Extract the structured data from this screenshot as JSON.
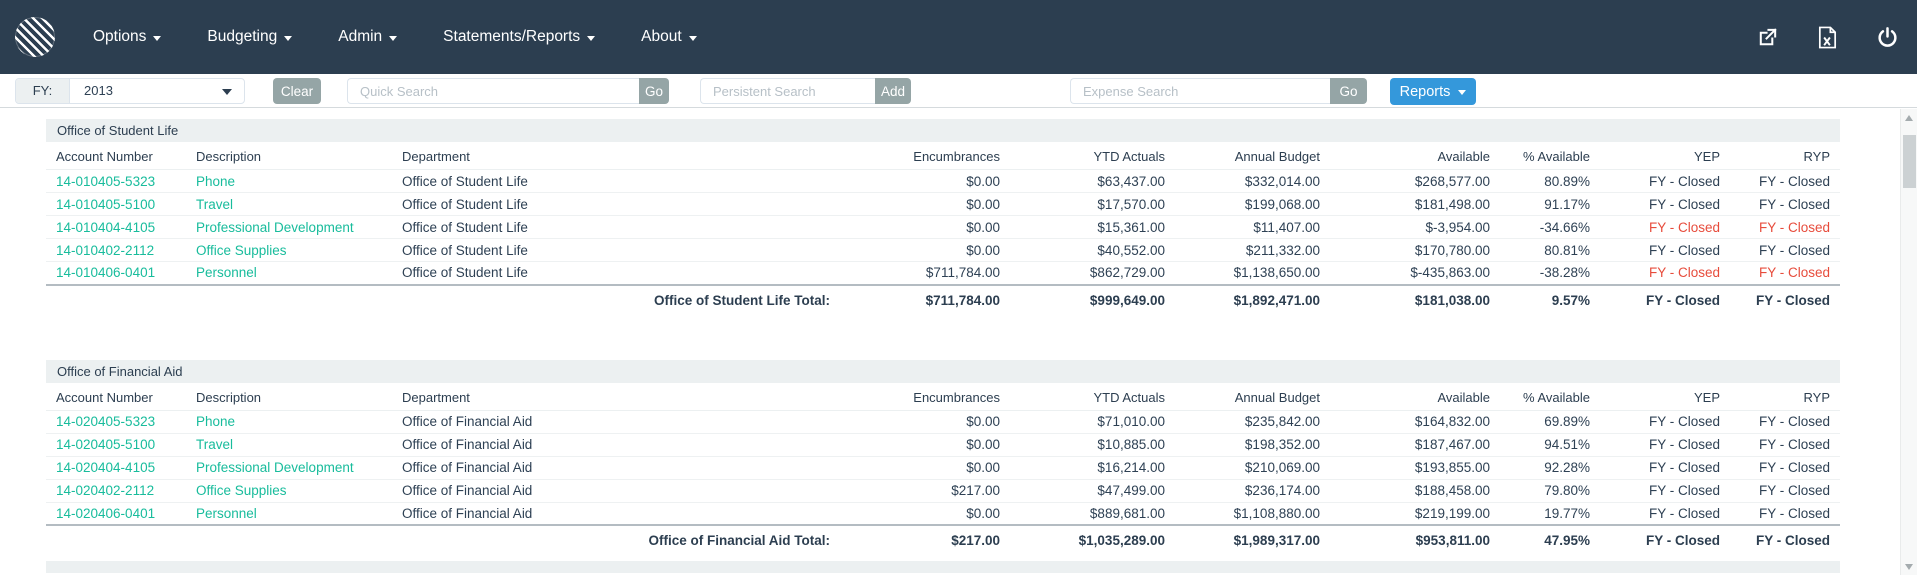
{
  "navbar": {
    "menus": [
      "Options",
      "Budgeting",
      "Admin",
      "Statements/Reports",
      "About"
    ],
    "icons": [
      "open-external-icon",
      "excel-export-icon",
      "power-icon"
    ]
  },
  "toolbar": {
    "fy_label": "FY:",
    "fy_value": "2013",
    "clear_label": "Clear",
    "quick_search_placeholder": "Quick Search",
    "quick_go_label": "Go",
    "persistent_search_placeholder": "Persistent Search",
    "persistent_add_label": "Add",
    "expense_search_placeholder": "Expense Search",
    "expense_go_label": "Go",
    "reports_label": "Reports"
  },
  "table": {
    "columns": [
      "Account Number",
      "Description",
      "Department",
      "Encumbrances",
      "YTD Actuals",
      "Annual Budget",
      "Available",
      "% Available",
      "YEP",
      "RYP"
    ],
    "sections": [
      {
        "name": "Office of Student Life",
        "rows": [
          {
            "account": "14-010405-5323",
            "description": "Phone",
            "department": "Office of Student Life",
            "encumbrances": "$0.00",
            "ytd": "$63,437.00",
            "annual": "$332,014.00",
            "available": "$268,577.00",
            "pct": "80.89%",
            "yep": "FY - Closed",
            "ryp": "FY - Closed",
            "negative": false
          },
          {
            "account": "14-010405-5100",
            "description": "Travel",
            "department": "Office of Student Life",
            "encumbrances": "$0.00",
            "ytd": "$17,570.00",
            "annual": "$199,068.00",
            "available": "$181,498.00",
            "pct": "91.17%",
            "yep": "FY - Closed",
            "ryp": "FY - Closed",
            "negative": false
          },
          {
            "account": "14-010404-4105",
            "description": "Professional Development",
            "department": "Office of Student Life",
            "encumbrances": "$0.00",
            "ytd": "$15,361.00",
            "annual": "$11,407.00",
            "available": "$-3,954.00",
            "pct": "-34.66%",
            "yep": "FY - Closed",
            "ryp": "FY - Closed",
            "negative": true
          },
          {
            "account": "14-010402-2112",
            "description": "Office Supplies",
            "department": "Office of Student Life",
            "encumbrances": "$0.00",
            "ytd": "$40,552.00",
            "annual": "$211,332.00",
            "available": "$170,780.00",
            "pct": "80.81%",
            "yep": "FY - Closed",
            "ryp": "FY - Closed",
            "negative": false
          },
          {
            "account": "14-010406-0401",
            "description": "Personnel",
            "department": "Office of Student Life",
            "encumbrances": "$711,784.00",
            "ytd": "$862,729.00",
            "annual": "$1,138,650.00",
            "available": "$-435,863.00",
            "pct": "-38.28%",
            "yep": "FY - Closed",
            "ryp": "FY - Closed",
            "negative": true
          }
        ],
        "total": {
          "label": "Office of Student Life Total:",
          "encumbrances": "$711,784.00",
          "ytd": "$999,649.00",
          "annual": "$1,892,471.00",
          "available": "$181,038.00",
          "pct": "9.57%",
          "yep": "FY - Closed",
          "ryp": "FY - Closed"
        }
      },
      {
        "name": "Office of Financial Aid",
        "rows": [
          {
            "account": "14-020405-5323",
            "description": "Phone",
            "department": "Office of Financial Aid",
            "encumbrances": "$0.00",
            "ytd": "$71,010.00",
            "annual": "$235,842.00",
            "available": "$164,832.00",
            "pct": "69.89%",
            "yep": "FY - Closed",
            "ryp": "FY - Closed",
            "negative": false
          },
          {
            "account": "14-020405-5100",
            "description": "Travel",
            "department": "Office of Financial Aid",
            "encumbrances": "$0.00",
            "ytd": "$10,885.00",
            "annual": "$198,352.00",
            "available": "$187,467.00",
            "pct": "94.51%",
            "yep": "FY - Closed",
            "ryp": "FY - Closed",
            "negative": false
          },
          {
            "account": "14-020404-4105",
            "description": "Professional Development",
            "department": "Office of Financial Aid",
            "encumbrances": "$0.00",
            "ytd": "$16,214.00",
            "annual": "$210,069.00",
            "available": "$193,855.00",
            "pct": "92.28%",
            "yep": "FY - Closed",
            "ryp": "FY - Closed",
            "negative": false
          },
          {
            "account": "14-020402-2112",
            "description": "Office Supplies",
            "department": "Office of Financial Aid",
            "encumbrances": "$217.00",
            "ytd": "$47,499.00",
            "annual": "$236,174.00",
            "available": "$188,458.00",
            "pct": "79.80%",
            "yep": "FY - Closed",
            "ryp": "FY - Closed",
            "negative": false
          },
          {
            "account": "14-020406-0401",
            "description": "Personnel",
            "department": "Office of Financial Aid",
            "encumbrances": "$0.00",
            "ytd": "$889,681.00",
            "annual": "$1,108,880.00",
            "available": "$219,199.00",
            "pct": "19.77%",
            "yep": "FY - Closed",
            "ryp": "FY - Closed",
            "negative": false
          }
        ],
        "total": {
          "label": "Office of Financial Aid Total:",
          "encumbrances": "$217.00",
          "ytd": "$1,035,289.00",
          "annual": "$1,989,317.00",
          "available": "$953,811.00",
          "pct": "47.95%",
          "yep": "FY - Closed",
          "ryp": "FY - Closed"
        }
      }
    ]
  },
  "colors": {
    "navbar_bg": "#2c3e50",
    "accent_teal": "#18bc9c",
    "negative_red": "#e74c3c",
    "button_gray": "#95a5a6",
    "reports_blue": "#3498db",
    "band_gray": "#ecf0f1"
  }
}
